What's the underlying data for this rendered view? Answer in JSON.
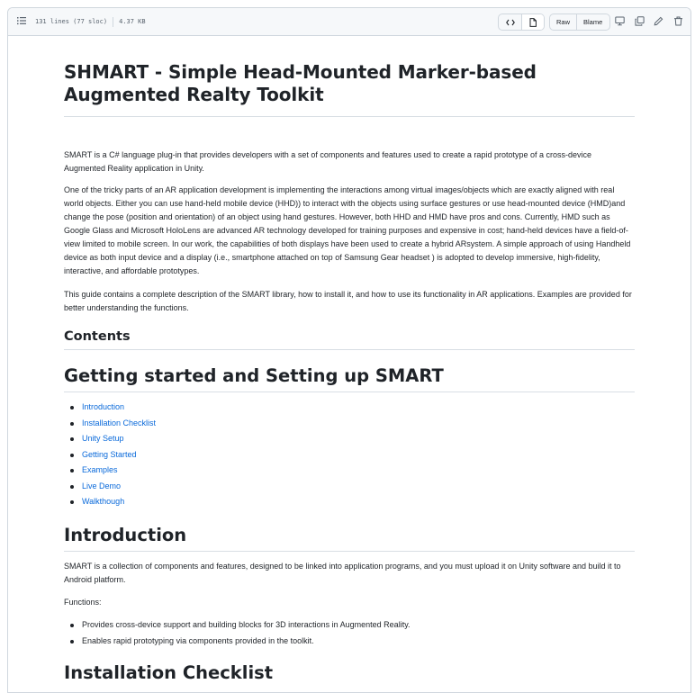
{
  "file_header": {
    "lines": "131 lines (77 sloc)",
    "size": "4.37 KB",
    "raw_label": "Raw",
    "blame_label": "Blame"
  },
  "readme": {
    "title": "SHMART - Simple Head-Mounted Marker-based Augmented Realty Toolkit",
    "intro_paragraphs": [
      "SMART is a C# language plug-in that provides developers with a set of components and features used to create a rapid prototype of a cross-device Augmented Reality application in Unity.",
      "One of the tricky parts of an AR application development is implementing the interactions among virtual images/objects which are exactly aligned with real world objects. Either you can use hand-held mobile device (HHD)) to interact with the objects using surface gestures or use head-mounted device (HMD)and change the pose (position and orientation) of an object using hand gestures. However, both HHD and HMD have pros and cons. Currently, HMD such as Google Glass and Microsoft HoloLens are advanced AR technology developed for training purposes and expensive in cost; hand-held devices have a field-of-view limited to mobile screen. In our work, the capabilities of both displays have been used to create a hybrid ARsystem. A simple approach of using Handheld device as both input device and a display (i.e., smartphone attached on top of Samsung Gear headset ) is adopted to develop immersive, high-fidelity, interactive, and affordable prototypes.",
      "This guide contains a complete description of the SMART library, how to install it, and how to use its functionality in AR applications. Examples are provided for better understanding the functions."
    ],
    "contents_heading": "Contents",
    "getting_started_heading": "Getting started and Setting up SMART",
    "toc_links": [
      "Introduction",
      "Installation Checklist",
      "Unity Setup",
      "Getting Started",
      "Examples",
      "Live Demo",
      "Walkthough"
    ],
    "introduction_heading": "Introduction",
    "introduction_paragraph": "SMART is a collection of components and features, designed to be linked into application programs, and you must upload it on Unity software and build it to Android platform.",
    "functions_label": "Functions:",
    "functions": [
      "Provides cross-device support and building blocks for 3D interactions in Augmented Reality.",
      "Enables rapid prototyping via components provided in the toolkit."
    ],
    "installation_heading": "Installation Checklist"
  }
}
